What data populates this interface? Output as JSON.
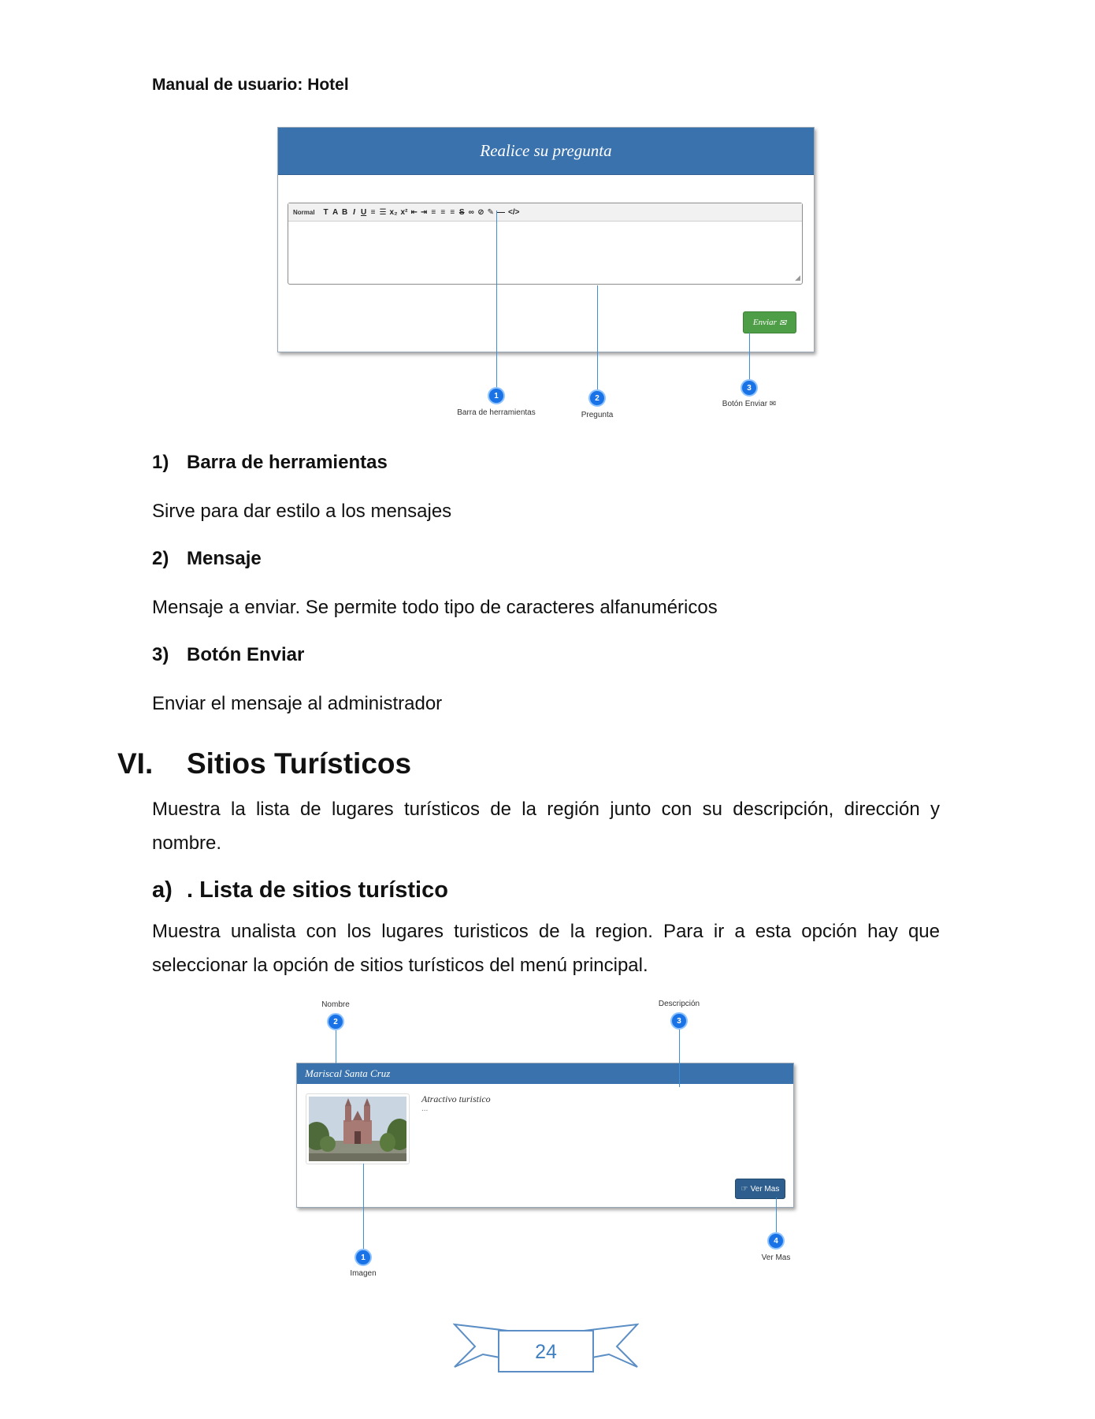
{
  "header": {
    "title": "Manual de usuario: Hotel"
  },
  "figure1": {
    "panel_title": "Realice su pregunta",
    "toolbar": {
      "style_select": "Normal",
      "buttons": [
        "T",
        "A",
        "B",
        "I",
        "U",
        "≡",
        "☰",
        "x₂",
        "x²",
        "⇤",
        "⇥",
        "≡",
        "≡",
        "≡",
        "S",
        "∞",
        "⊘",
        "✎",
        "—",
        "</>"
      ]
    },
    "send_button": "Enviar",
    "callouts": [
      {
        "number": "1",
        "label": "Barra de herramientas"
      },
      {
        "number": "2",
        "label": "Pregunta"
      },
      {
        "number": "3",
        "label": "Botón Enviar"
      }
    ],
    "colors": {
      "header": "#3a72ad",
      "send_button": "#4e9e47",
      "callout": "#1a73e6"
    }
  },
  "items": [
    {
      "number": "1)",
      "title": "Barra de herramientas",
      "description": "Sirve para dar estilo a los mensajes"
    },
    {
      "number": "2)",
      "title": "Mensaje",
      "description": "Mensaje a enviar. Se permite todo tipo de caracteres alfanuméricos"
    },
    {
      "number": "3)",
      "title": "Botón Enviar",
      "description": "Enviar el mensaje al administrador"
    }
  ],
  "section": {
    "number": "VI.",
    "title": "Sitios Turísticos",
    "intro": "Muestra la lista de lugares turísticos de la región junto con su descripción, dirección y nombre."
  },
  "subsection": {
    "number": "a)",
    "title": ". Lista de sitios turístico",
    "text": "Muestra unalista con los lugares turisticos de la region. Para ir a esta opción hay que seleccionar la opción de sitios turísticos del menú principal."
  },
  "figure2": {
    "panel_title": "Mariscal Santa Cruz",
    "category": "Atractivo turistico",
    "ellipsis": "...",
    "button": "Ver Mas",
    "callouts": [
      {
        "number": "1",
        "label": "Imagen"
      },
      {
        "number": "2",
        "label": "Nombre"
      },
      {
        "number": "3",
        "label": "Descripción"
      },
      {
        "number": "4",
        "label": "Ver Mas"
      }
    ],
    "colors": {
      "button": "#2e5e8e"
    }
  },
  "footer": {
    "page_number": "24"
  }
}
